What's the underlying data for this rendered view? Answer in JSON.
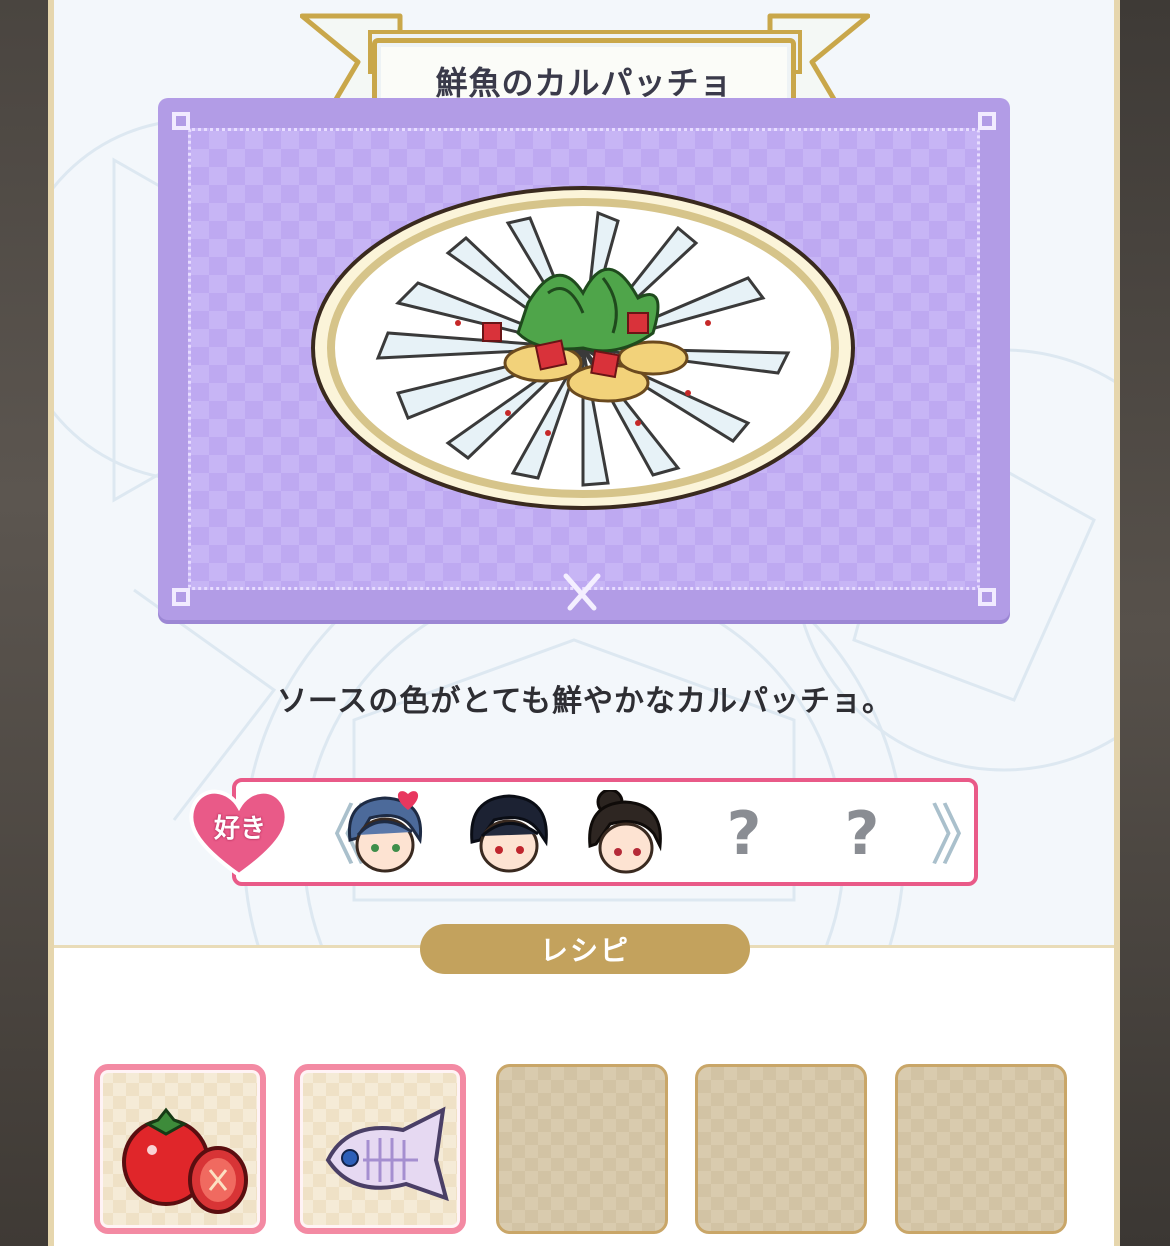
{
  "dish": {
    "title": "鮮魚のカルパッチョ",
    "description": "ソースの色がとても鮮やかなカルパッチョ。"
  },
  "likes": {
    "badge_label": "好き",
    "prev_arrow": "《",
    "next_arrow": "》",
    "characters": [
      {
        "name": "character-1",
        "favorite": true
      },
      {
        "name": "character-2",
        "favorite": false
      },
      {
        "name": "character-3",
        "favorite": false
      },
      {
        "unknown_label": "?"
      },
      {
        "unknown_label": "?"
      }
    ]
  },
  "recipe": {
    "label": "レシピ",
    "ingredients": [
      {
        "icon": "tomato-icon",
        "filled": true
      },
      {
        "icon": "fish-icon",
        "filled": true
      },
      {
        "filled": false
      },
      {
        "filled": false
      },
      {
        "filled": false
      }
    ]
  },
  "colors": {
    "card": "#b29ce6",
    "likes_border": "#e95a88",
    "recipe_pill": "#c3a25d",
    "slot_filled_border": "#f38aa3"
  }
}
